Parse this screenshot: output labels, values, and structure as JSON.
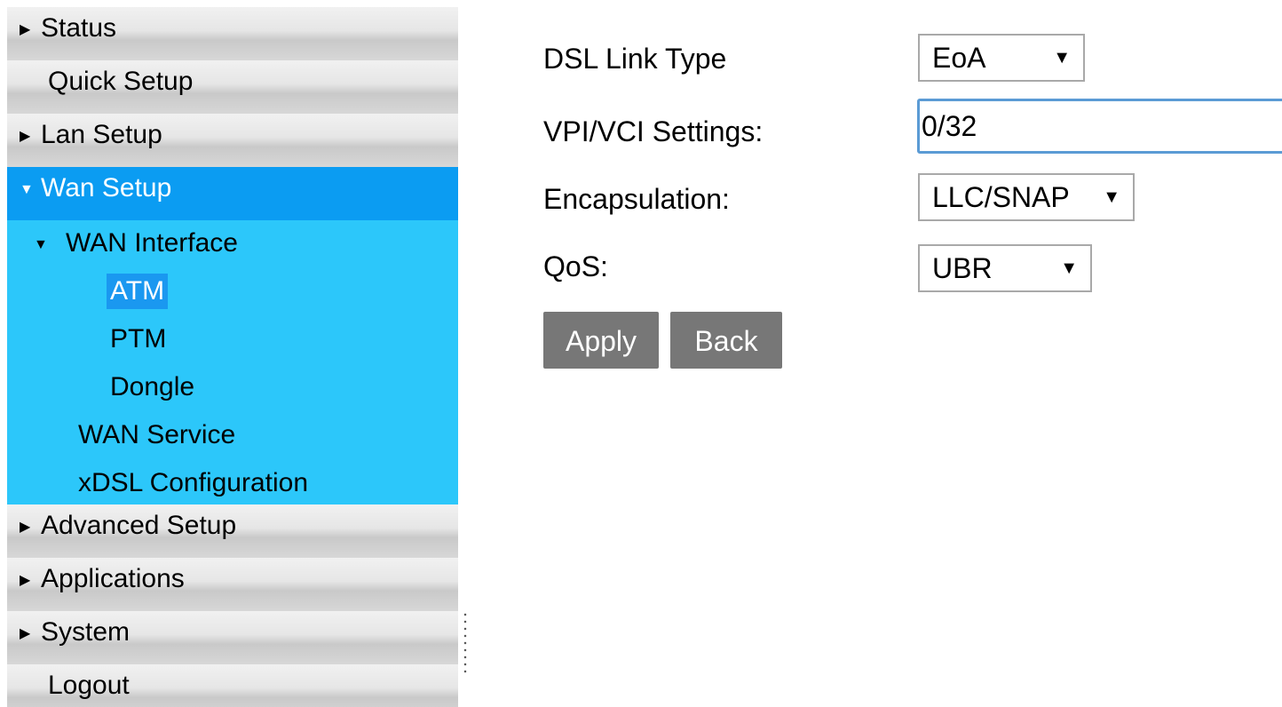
{
  "sidebar": {
    "status": "Status",
    "quick_setup": "Quick Setup",
    "lan_setup": "Lan Setup",
    "wan_setup": "Wan Setup",
    "wan_sub": {
      "wan_interface": "WAN Interface",
      "atm": "ATM",
      "ptm": "PTM",
      "dongle": "Dongle",
      "wan_service": "WAN Service",
      "xdsl_configuration": "xDSL Configuration"
    },
    "advanced_setup": "Advanced Setup",
    "applications": "Applications",
    "system": "System",
    "logout": "Logout"
  },
  "form": {
    "dsl_link_type_label": "DSL Link Type",
    "dsl_link_type_value": "EoA",
    "vpi_vci_label": "VPI/VCI Settings:",
    "vpi_vci_value": "0/32",
    "encapsulation_label": "Encapsulation:",
    "encapsulation_value": "LLC/SNAP",
    "qos_label": "QoS:",
    "qos_value": "UBR"
  },
  "buttons": {
    "apply": "Apply",
    "back": "Back"
  },
  "colors": {
    "active_menu": "#0b9cf2",
    "submenu_bg": "#2cc7fa",
    "selected_item": "#1a98f0",
    "button_bg": "#777777",
    "input_focus_border": "#5b9bd5"
  }
}
